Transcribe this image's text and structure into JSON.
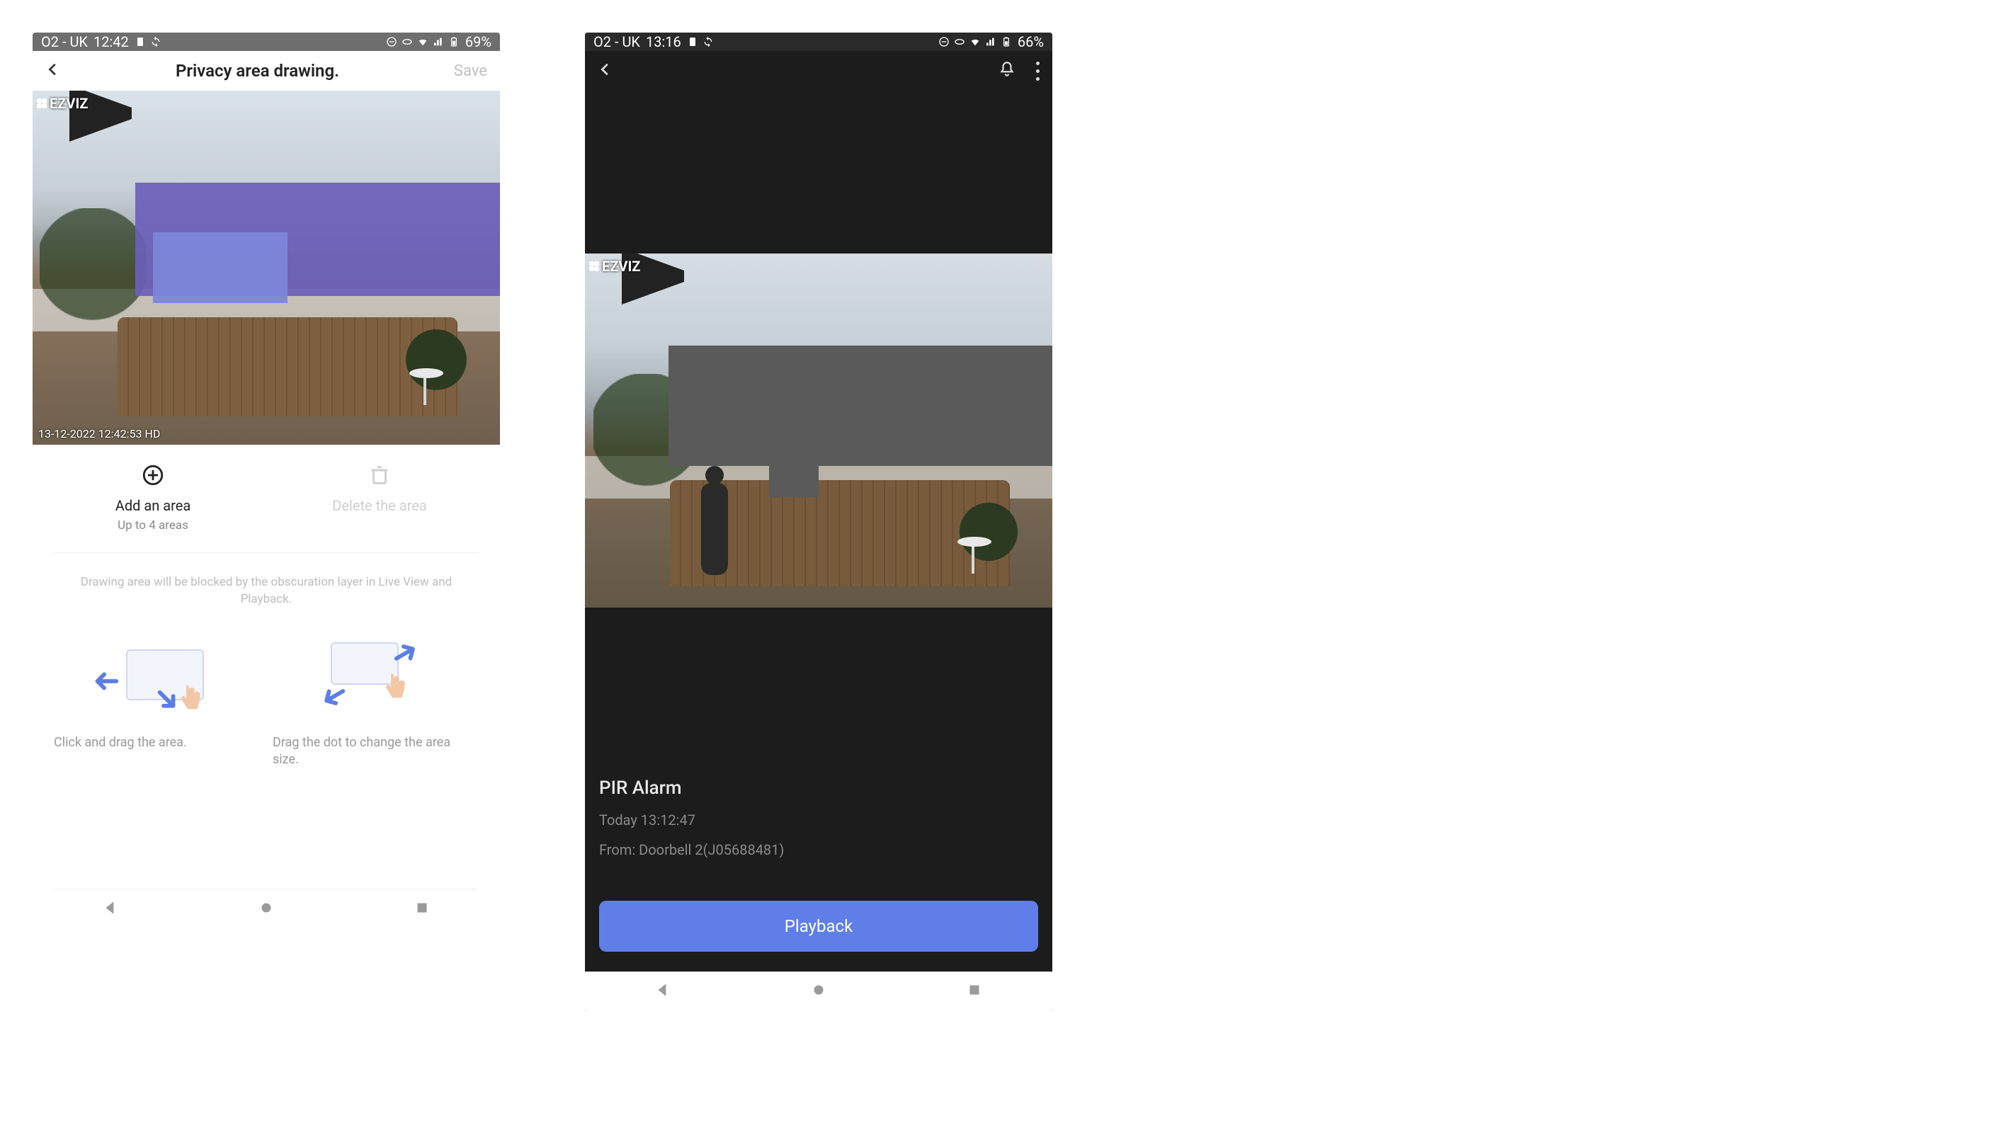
{
  "phone1": {
    "status": {
      "carrier": "O2 - UK",
      "time": "12:42",
      "battery": "69%"
    },
    "appbar": {
      "title": "Privacy area drawing.",
      "save_label": "Save"
    },
    "camera": {
      "watermark": "EZVIZ",
      "overlay_ts": "13-12-2022  12:42:53   HD"
    },
    "actions": {
      "add": {
        "title": "Add an area",
        "sub": "Up to 4 areas"
      },
      "delete": {
        "title": "Delete the area"
      }
    },
    "note": "Drawing area will be blocked by the obscuration layer in Live View and Playback.",
    "hints": {
      "left": "Click and drag the area.",
      "right": "Drag the dot to change the area size."
    }
  },
  "phone2": {
    "status": {
      "carrier": "O2 - UK",
      "time": "13:16",
      "battery": "66%"
    },
    "camera": {
      "watermark": "EZVIZ"
    },
    "info": {
      "title": "PIR Alarm",
      "time": "Today 13:12:47",
      "from": "From: Doorbell 2(J05688481)"
    },
    "playback_label": "Playback"
  }
}
